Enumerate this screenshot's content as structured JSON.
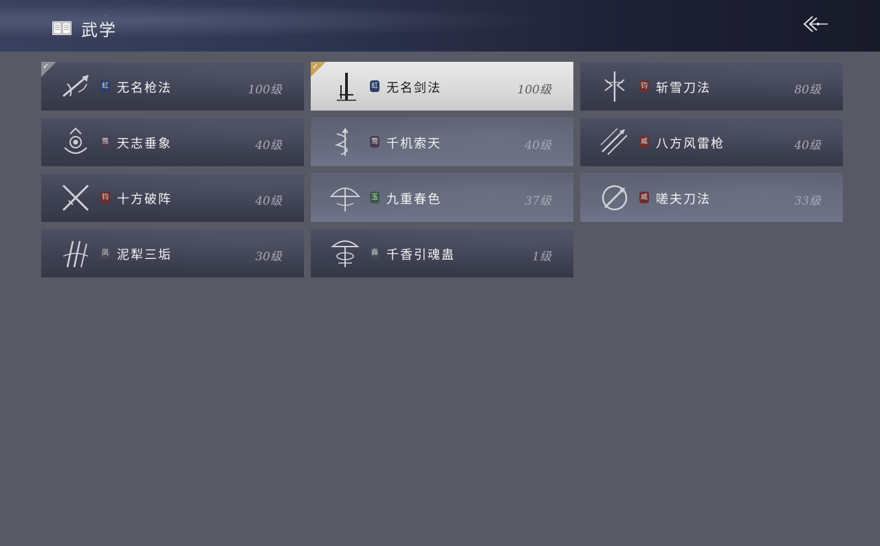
{
  "header": {
    "title": "武学",
    "icons": {
      "book": "book-icon",
      "back": "back-arrow-icon"
    }
  },
  "skills": [
    {
      "name": "无名枪法",
      "level": "100级",
      "badge": "虹",
      "badge_color": "#2b3f6b",
      "icon": "spear-icon",
      "selected": false,
      "equipped": true,
      "equipped_style": "gray"
    },
    {
      "name": "无名剑法",
      "level": "100级",
      "badge": "虹",
      "badge_color": "#2b3f6b",
      "icon": "sword-icon",
      "selected": true,
      "equipped": true,
      "equipped_style": "gold"
    },
    {
      "name": "斩雪刀法",
      "level": "80级",
      "badge": "钧",
      "badge_color": "#6b2e2e",
      "icon": "blade-snow-icon",
      "selected": false,
      "equipped": false
    },
    {
      "name": "天志垂象",
      "level": "40级",
      "badge": "莺",
      "badge_color": "#4b3c52",
      "icon": "fan-hand-icon",
      "selected": false,
      "equipped": false
    },
    {
      "name": "千机索天",
      "level": "40级",
      "badge": "莺",
      "badge_color": "#4b3c52",
      "icon": "rope-dart-icon",
      "selected": false,
      "equipped": false
    },
    {
      "name": "八方风雷枪",
      "level": "40级",
      "badge": "威",
      "badge_color": "#6b2e2e",
      "icon": "thunder-spear-icon",
      "selected": false,
      "equipped": false
    },
    {
      "name": "十方破阵",
      "level": "40级",
      "badge": "钧",
      "badge_color": "#6b2e2e",
      "icon": "crossed-blades-icon",
      "selected": false,
      "equipped": false
    },
    {
      "name": "九重春色",
      "level": "37级",
      "badge": "玉",
      "badge_color": "#3a5a44",
      "icon": "umbrella-icon",
      "selected": false,
      "equipped": false
    },
    {
      "name": "嗟夫刀法",
      "level": "33级",
      "badge": "威",
      "badge_color": "#6b2e2e",
      "icon": "ring-blade-icon",
      "selected": false,
      "equipped": false
    },
    {
      "name": "泥犁三垢",
      "level": "30级",
      "badge": "凤",
      "badge_color": "#4a4a5a",
      "icon": "triple-blade-icon",
      "selected": false,
      "equipped": false
    },
    {
      "name": "千香引魂蛊",
      "level": "1级",
      "badge": "霖",
      "badge_color": "#3f4a52",
      "icon": "lantern-icon",
      "selected": false,
      "equipped": false
    }
  ]
}
